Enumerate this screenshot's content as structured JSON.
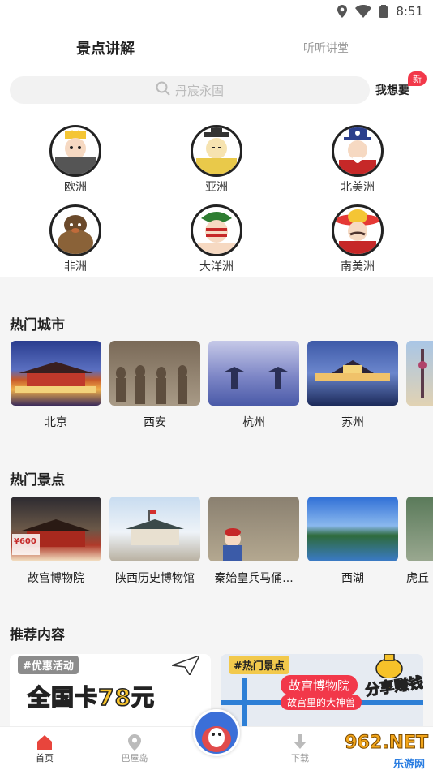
{
  "status_bar": {
    "time": "8:51"
  },
  "tabs": {
    "active": "景点讲解",
    "inactive": "听听讲堂"
  },
  "search": {
    "placeholder": "丹宸永固",
    "wish_label": "我想要",
    "new_badge": "新"
  },
  "continents": [
    {
      "label": "欧洲"
    },
    {
      "label": "亚洲"
    },
    {
      "label": "北美洲"
    },
    {
      "label": "非洲"
    },
    {
      "label": "大洋洲"
    },
    {
      "label": "南美洲"
    }
  ],
  "hot_cities": {
    "title": "热门城市",
    "items": [
      {
        "label": "北京"
      },
      {
        "label": "西安"
      },
      {
        "label": "杭州"
      },
      {
        "label": "苏州"
      },
      {
        "label": ""
      }
    ]
  },
  "hot_spots": {
    "title": "热门景点",
    "items": [
      {
        "label": "故宫博物院",
        "overlay": "¥600"
      },
      {
        "label": "陕西历史博物馆"
      },
      {
        "label": "秦始皇兵马俑..."
      },
      {
        "label": "西湖"
      },
      {
        "label": "虎丘"
      }
    ]
  },
  "recommend": {
    "title": "推荐内容",
    "card1": {
      "tag": "#优惠活动",
      "headline": "全国卡78元"
    },
    "card2": {
      "tag": "#热门景点",
      "headline": "故宫博物院",
      "sub": "故宫里的大神兽",
      "side": "分享赚钱"
    }
  },
  "bottom_nav": [
    {
      "label": "首页",
      "icon": "home-icon"
    },
    {
      "label": "巴屋岛",
      "icon": "location-icon"
    },
    {
      "label": "下载",
      "icon": "download-icon"
    }
  ],
  "watermark": {
    "brand": "962.NET",
    "sub": "乐游网"
  },
  "colors": {
    "accent": "#f2384a",
    "tab_underline": "#ff8a9a",
    "home_active": "#e8453c"
  }
}
